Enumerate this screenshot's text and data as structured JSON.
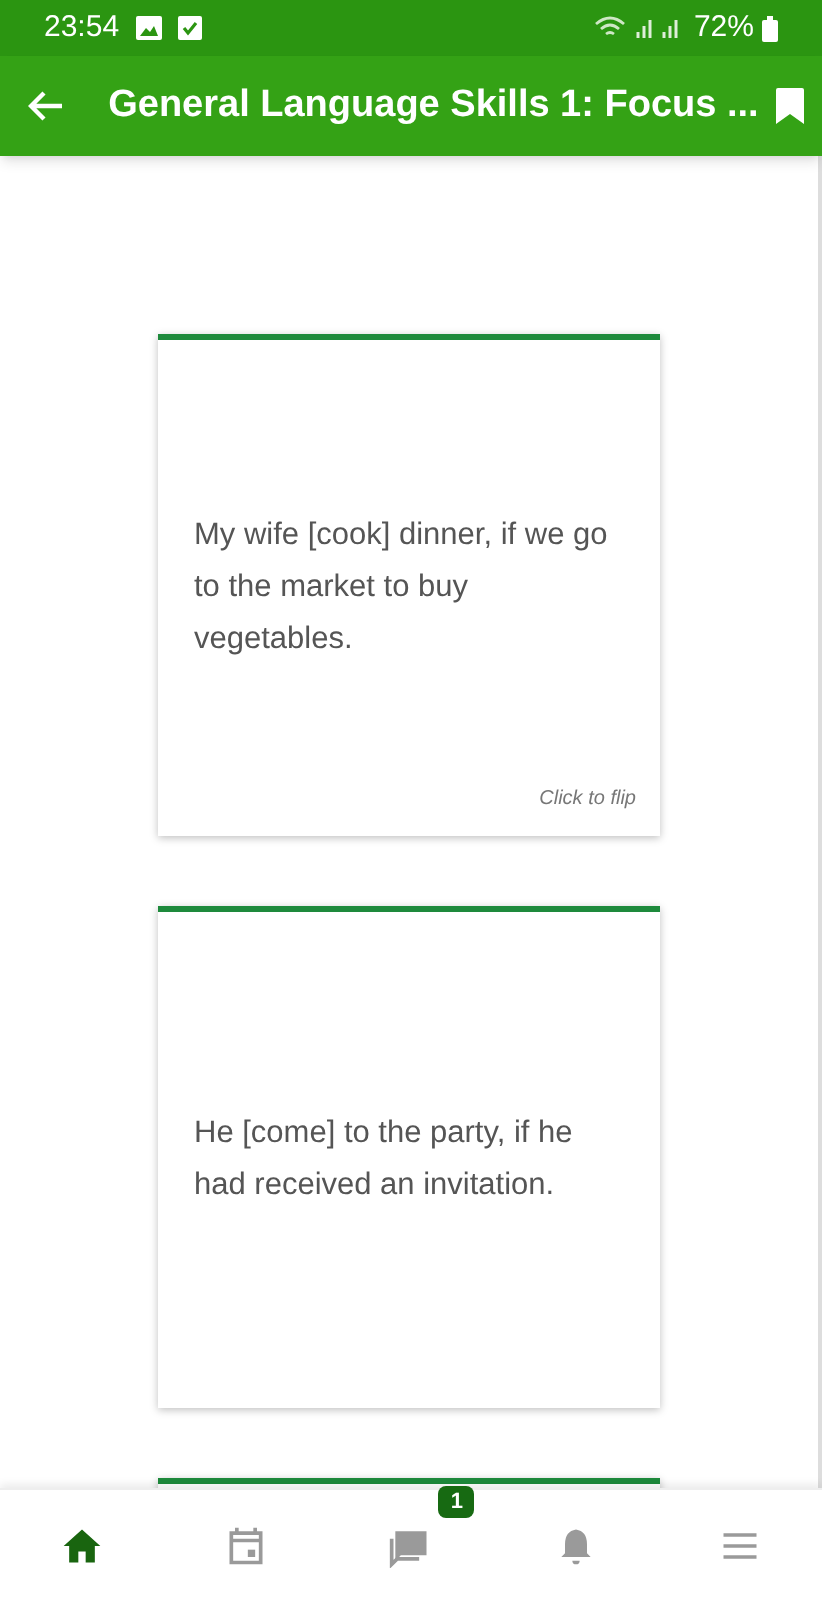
{
  "status_bar": {
    "time": "23:54",
    "battery": "72%"
  },
  "app_bar": {
    "title": "General Language Skills 1: Focus ..."
  },
  "cards": [
    {
      "kind": "flashcard",
      "text": "My wife [cook] dinner, if we go to the market to buy vegetables.",
      "hint": "Click to flip"
    },
    {
      "kind": "flashcard",
      "text": "He [come] to the party, if he had received an invitation."
    },
    {
      "kind": "flashcard"
    }
  ],
  "bottom_nav": [
    {
      "kind": "home",
      "selected": true
    },
    {
      "kind": "calendar",
      "selected": false
    },
    {
      "kind": "chat",
      "selected": false,
      "badge": "1"
    },
    {
      "kind": "bell",
      "selected": false
    },
    {
      "kind": "menu",
      "selected": false
    }
  ]
}
